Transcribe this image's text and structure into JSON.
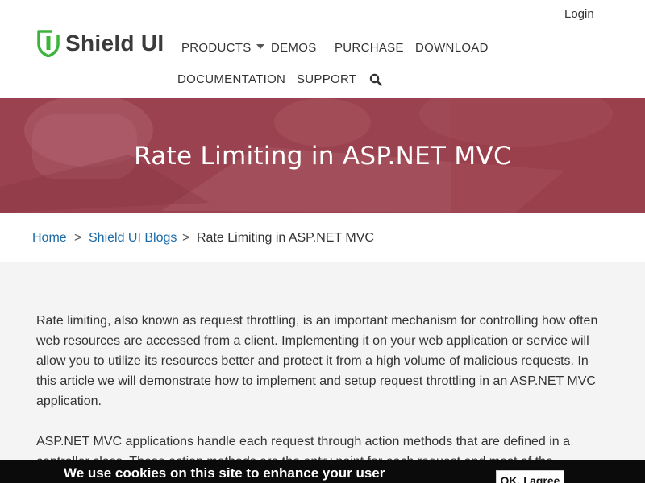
{
  "header": {
    "logo_text": "Shield UI",
    "login_label": "Login",
    "nav": {
      "products": "PRODUCTS",
      "demos": "DEMOS",
      "purchase": "PURCHASE",
      "download": "DOWNLOAD",
      "documentation": "DOCUMENTATION",
      "support": "SUPPORT"
    },
    "logo_color": "#3cb43c"
  },
  "hero": {
    "title": "Rate Limiting in ASP.NET MVC",
    "overlay_color": "#9c3f4d"
  },
  "breadcrumb": {
    "home": "Home",
    "sep1": ">",
    "blogs": "Shield UI Blogs",
    "sep2": ">",
    "current": "Rate Limiting in ASP.NET MVC",
    "link_color": "#1a6aa8"
  },
  "article": {
    "paragraphs": [
      "Rate limiting, also known as request throttling, is an important mechanism for controlling how often web resources are accessed from a client. Implementing it on your web application or service will allow you to utilize its resources better and protect it from a high volume of malicious requests. In this article we will demonstrate how to implement and setup request throttling in an ASP.NET MVC application.",
      "ASP.NET MVC applications handle each request through action methods that are defined in a controller class. These action methods are the entry point for each request and most of the"
    ]
  },
  "cookie": {
    "text": "We use cookies on this site to enhance your user",
    "button_label": "OK, I agree"
  }
}
